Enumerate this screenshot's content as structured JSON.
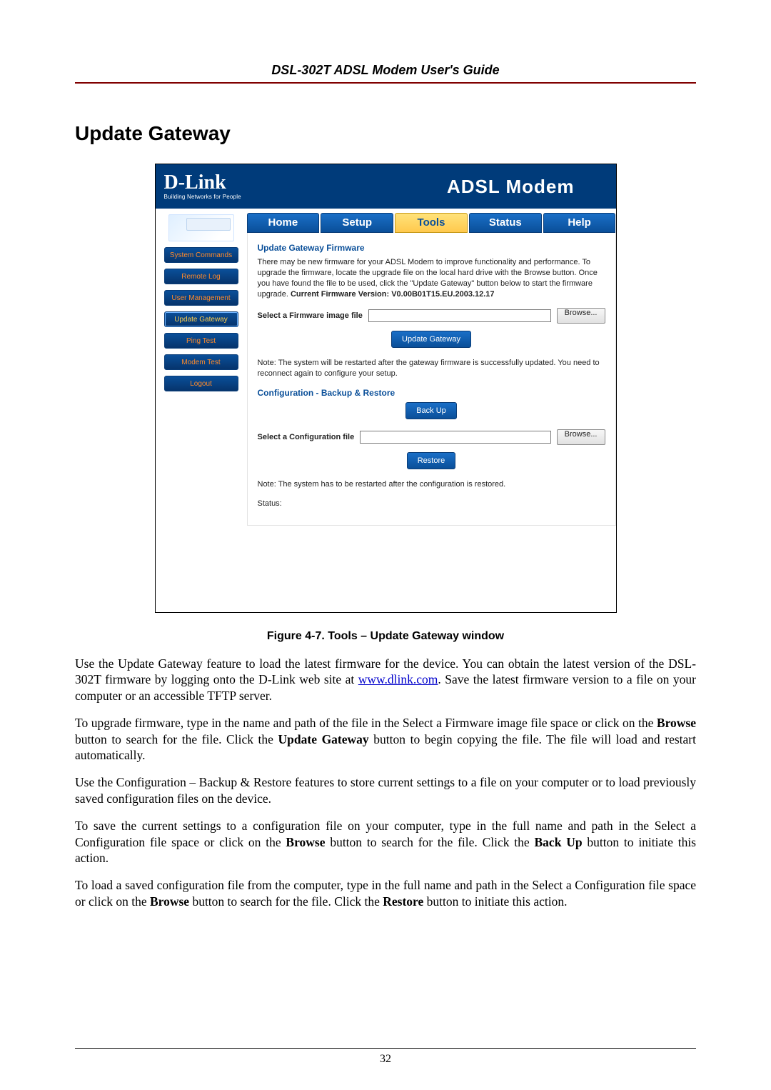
{
  "header": {
    "title": "DSL-302T ADSL Modem User's Guide"
  },
  "section": {
    "title": "Update Gateway"
  },
  "ui": {
    "brand": {
      "logo": "D-Link",
      "tagline": "Building Networks for People",
      "product": "ADSL Modem"
    },
    "tabs": [
      {
        "label": "Home",
        "active": false
      },
      {
        "label": "Setup",
        "active": false
      },
      {
        "label": "Tools",
        "active": true
      },
      {
        "label": "Status",
        "active": false
      },
      {
        "label": "Help",
        "active": false
      }
    ],
    "sidebar": [
      {
        "label": "System Commands",
        "active": false
      },
      {
        "label": "Remote Log",
        "active": false
      },
      {
        "label": "User Management",
        "active": false
      },
      {
        "label": "Update Gateway",
        "active": true
      },
      {
        "label": "Ping Test",
        "active": false
      },
      {
        "label": "Modem Test",
        "active": false
      },
      {
        "label": "Logout",
        "active": false
      }
    ],
    "firmware": {
      "heading": "Update Gateway Firmware",
      "desc_prefix": "There may be new firmware for your ADSL Modem to improve functionality and performance. To upgrade the firmware, locate the upgrade file on the local hard drive with the Browse button. Once you have found the file to be used, click the \"Update Gateway\" button below to start the firmware upgrade. ",
      "version_label": "Current Firmware Version:  ",
      "version_value": "V0.00B01T15.EU.2003.12.17",
      "file_label": "Select a Firmware image file",
      "browse": "Browse...",
      "update_btn": "Update Gateway",
      "note": "Note: The system will be restarted after the gateway firmware is successfully updated. You need to reconnect again to configure your setup."
    },
    "config": {
      "heading": "Configuration - Backup & Restore",
      "backup_btn": "Back Up",
      "file_label": "Select a Configuration file",
      "browse": "Browse...",
      "restore_btn": "Restore",
      "note": "Note: The system has to be restarted after the configuration is restored.",
      "status_label": "Status:"
    }
  },
  "figure": {
    "caption": "Figure 4-7. Tools – Update Gateway window"
  },
  "paragraphs": {
    "p1a": "Use the Update Gateway feature to load the latest firmware for the device. You can obtain the latest version of the DSL-302T firmware by logging onto the D-Link web site at ",
    "p1_link": "www.dlink.com",
    "p1b": ". Save the latest firmware version to a file on your computer or an accessible TFTP server.",
    "p2a": "To upgrade firmware, type in the name and path of the file in the Select a Firmware image file space or click on the ",
    "p2b": " button to search for the file. Click the ",
    "p2c": " button to begin copying the file. The file will load and restart automatically.",
    "p3": "Use the Configuration – Backup & Restore features to store current settings to a file on your computer or to load previously saved configuration files on the device.",
    "p4a": "To save the current settings to a configuration file on your computer, type in the full name and path in the Select a Configuration file space or click on the ",
    "p4b": " button to search for the file. Click the ",
    "p4c": " button to initiate this action.",
    "p5a": "To load a saved configuration file from the computer, type in the full name and path in the Select a Configuration file space or click on the ",
    "p5b": " button to search for the file. Click the ",
    "p5c": " button to initiate this action.",
    "bold": {
      "browse": "Browse",
      "update": "Update Gateway",
      "backup": "Back Up",
      "restore": "Restore"
    }
  },
  "page_number": "32"
}
